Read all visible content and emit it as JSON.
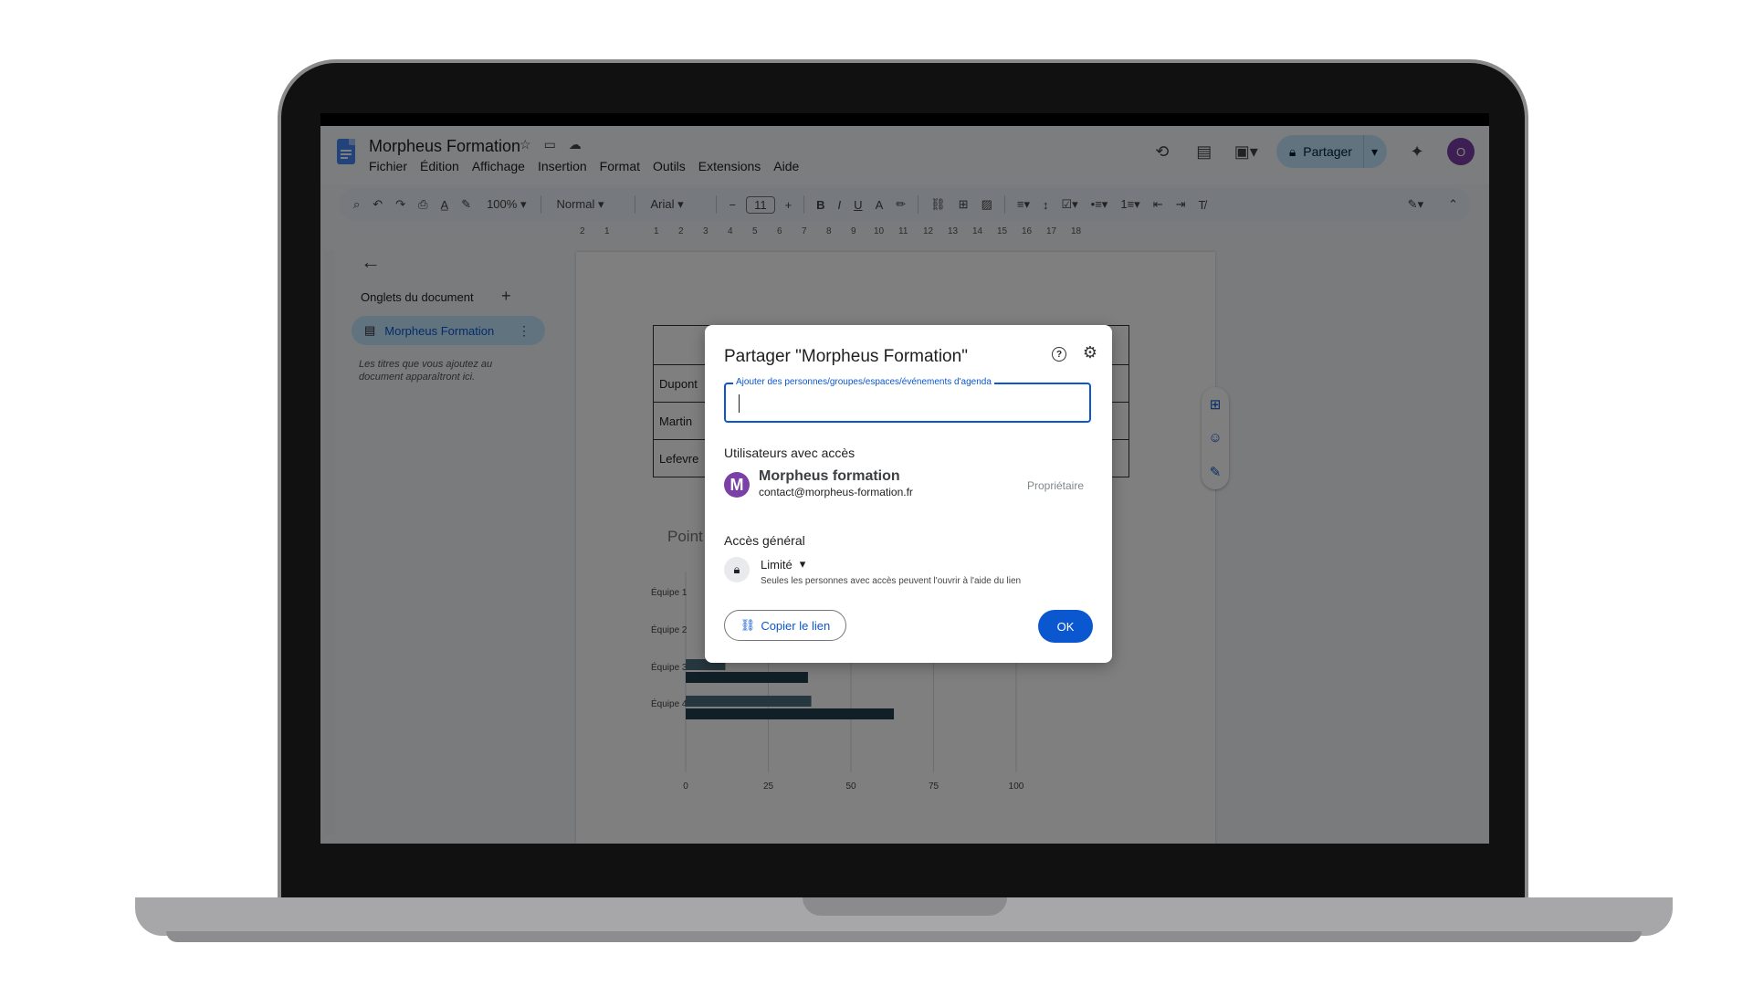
{
  "document": {
    "title": "Morpheus Formation",
    "menu": [
      "Fichier",
      "Édition",
      "Affichage",
      "Insertion",
      "Format",
      "Outils",
      "Extensions",
      "Aide"
    ]
  },
  "header": {
    "share_label": "Partager",
    "avatar_letter": "O",
    "colors": {
      "share_bg": "#c2e7ff",
      "avatar_bg": "#7b3fa8"
    }
  },
  "toolbar": {
    "zoom": "100%",
    "style": "Normal",
    "font": "Arial",
    "font_size": "11"
  },
  "ruler": [
    "2",
    "1",
    "1",
    "2",
    "3",
    "4",
    "5",
    "6",
    "7",
    "8",
    "9",
    "10",
    "11",
    "12",
    "13",
    "14",
    "15",
    "16",
    "17",
    "18"
  ],
  "sidebar": {
    "title": "Onglets du document",
    "tab_label": "Morpheus Formation",
    "hint": "Les titres que vous ajoutez au document apparaîtront ici."
  },
  "doc_table": {
    "header": "No",
    "rows": [
      "Dupont",
      "Martin",
      "Lefevre"
    ]
  },
  "chart_title_partial": "Point",
  "chart_data": {
    "type": "bar",
    "orientation": "horizontal",
    "categories": [
      "Équipe 3",
      "Équipe 4"
    ],
    "visible_category_labels_partial": [
      "Équipe 1",
      "Équipe 2"
    ],
    "series": [
      {
        "values": [
          12,
          38
        ]
      },
      {
        "values": [
          37,
          63
        ]
      }
    ],
    "xlim": [
      0,
      100
    ],
    "x_ticks": [
      "0",
      "25",
      "50",
      "75",
      "100"
    ],
    "colors": [
      "#4e6e7e",
      "#23414f"
    ]
  },
  "dialog": {
    "title": "Partager \"Morpheus Formation\"",
    "add_label": "Ajouter des personnes/groupes/espaces/événements d'agenda",
    "add_value": "",
    "users_heading": "Utilisateurs avec accès",
    "user": {
      "initial": "M",
      "name": "Morpheus formation",
      "email": "contact@morpheus-formation.fr",
      "role": "Propriétaire"
    },
    "general_heading": "Accès général",
    "access_level": "Limité",
    "access_description": "Seules les personnes avec accès peuvent l'ouvrir à l'aide du lien",
    "copy_link_label": "Copier le lien",
    "ok_label": "OK",
    "colors": {
      "primary": "#0b57d0"
    }
  }
}
